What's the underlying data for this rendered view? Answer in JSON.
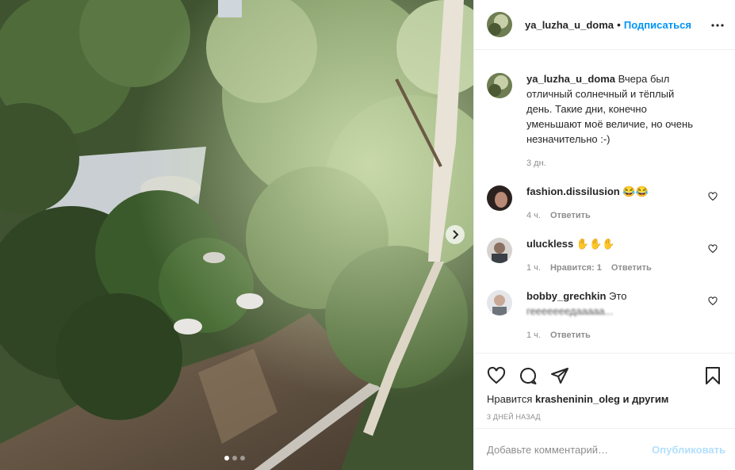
{
  "post": {
    "author": "ya_luzha_u_doma",
    "separator": "•",
    "follow_label": "Подписаться",
    "more_icon": "more-dots-icon"
  },
  "caption": {
    "username": "ya_luzha_u_doma",
    "text": "Вчера был отличный солнечный и тёплый день. Такие дни, конечно уменьшают моё величие, но очень незначительно :-)",
    "time": "3 дн."
  },
  "comments": [
    {
      "username": "fashion.dissilusion",
      "text": "😂😂",
      "time": "4 ч.",
      "reply": "Ответить"
    },
    {
      "username": "uluckless",
      "text": "✋✋✋",
      "time": "1 ч.",
      "likes": "Нравится: 1",
      "reply": "Ответить"
    },
    {
      "username": "bobby_grechkin",
      "text": "Это",
      "text_blurred": "гееееееедааааа...",
      "time": "1 ч.",
      "reply": "Ответить"
    }
  ],
  "likes": {
    "prefix": "Нравится",
    "user": "krasheninin_oleg",
    "suffix": "и другим"
  },
  "date": "3 дней назад",
  "add_comment": {
    "placeholder": "Добавьте комментарий…",
    "publish_label": "Опубликовать"
  },
  "carousel": {
    "slides": 3,
    "active": 1
  },
  "colors": {
    "link": "#0095f6",
    "publish_disabled": "#b2dffc",
    "muted": "#8e8e8e",
    "text": "#262626"
  }
}
